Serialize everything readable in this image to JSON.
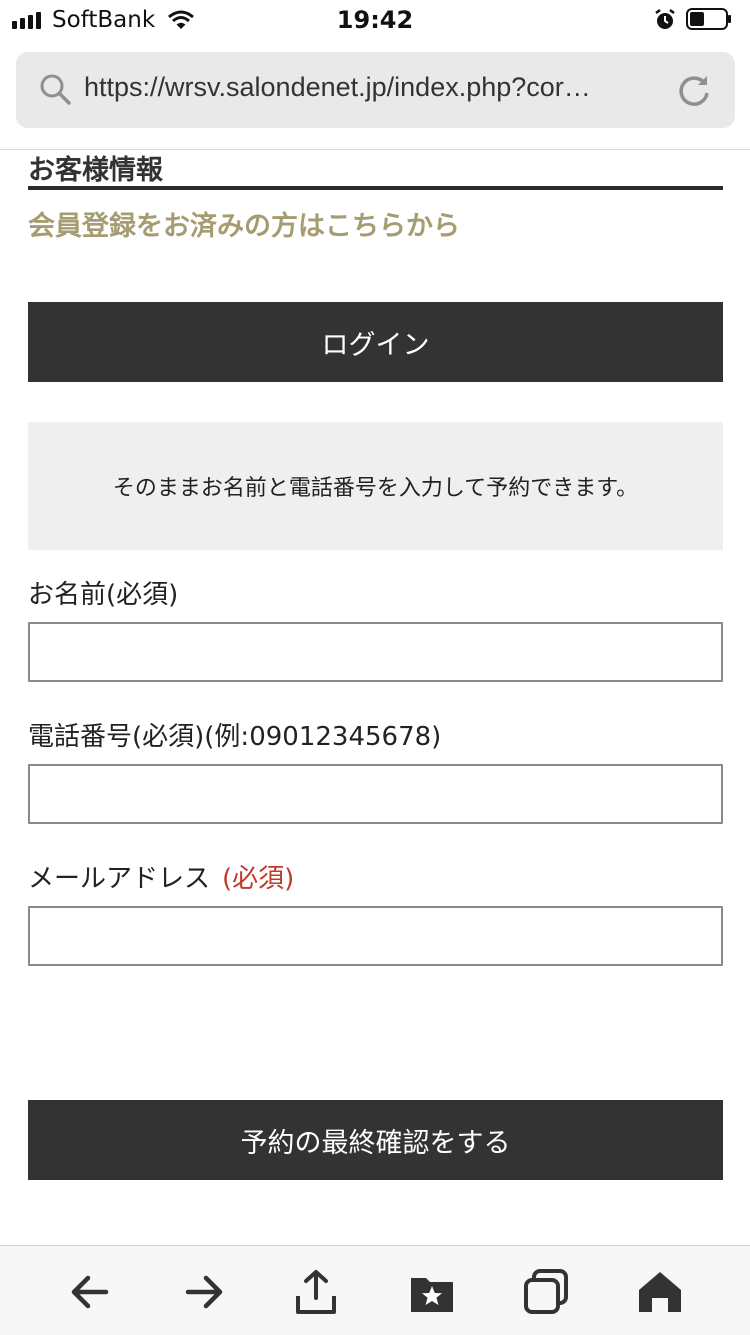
{
  "status": {
    "carrier": "SoftBank",
    "time": "19:42"
  },
  "browser": {
    "url": "https://wrsv.salondenet.jp/index.php?cor…"
  },
  "form": {
    "section_title": "お客様情報",
    "member_link": "会員登録をお済みの方はこちらから",
    "login_label": "ログイン",
    "notice": "そのままお名前と電話番号を入力して予約できます。",
    "name_label": "お名前(必須)",
    "name_value": "",
    "phone_label": "電話番号(必須)(例:09012345678)",
    "phone_value": "",
    "email_label": "メールアドレス",
    "email_required": "(必須)",
    "email_value": "",
    "confirm_label": "予約の最終確認をする"
  },
  "toolbar": {
    "icons": [
      "back-icon",
      "forward-icon",
      "share-icon",
      "bookmarks-icon",
      "tabs-icon",
      "home-icon"
    ]
  }
}
